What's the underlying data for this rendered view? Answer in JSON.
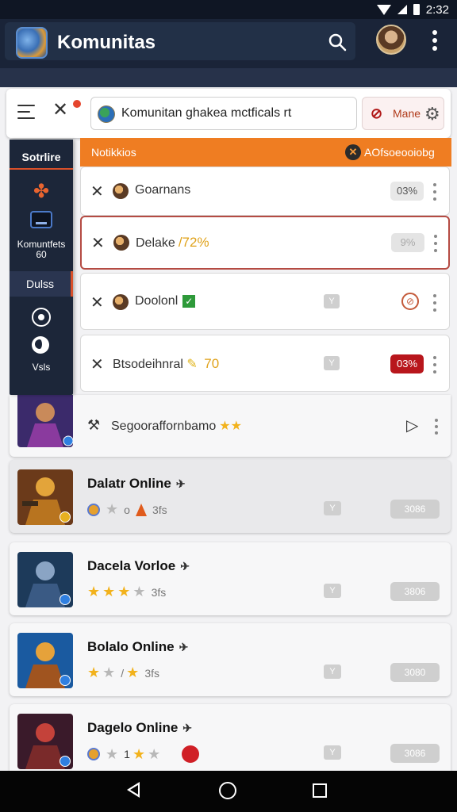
{
  "status_bar": {
    "time": "2:32"
  },
  "app_bar": {
    "title": "Komunitas"
  },
  "toolbar": {
    "field_text": "Komunitan ghakea mctficals rt",
    "right_label": "Mane"
  },
  "side_panel": {
    "header": "Sotrlire",
    "item1_label": "Komuntfets 60",
    "section2": "Dulss",
    "item2_label": "Vsls"
  },
  "notifications": {
    "header_title": "Notikkios",
    "header_right": "AOfsoeooiobg",
    "rows": [
      {
        "text": "Goarnans",
        "pct": "03%"
      },
      {
        "text": "Delake",
        "extra": "/72%",
        "pct": "9%"
      },
      {
        "text": "Doolonl",
        "tag": "Y"
      },
      {
        "text": "Btsodeihnral",
        "extra": "70",
        "tag": "Y",
        "pct": "03%"
      }
    ]
  },
  "partial_card": {
    "text": "Segooraffornbamo",
    "stars": "★★"
  },
  "games": [
    {
      "title": "Dalatr Online",
      "rating_text": "3fs",
      "tag": "Y",
      "button": "3086"
    },
    {
      "title": "Dacela Vorloe",
      "rating_text": "3fs",
      "tag": "Y",
      "button": "3806"
    },
    {
      "title": "Bolalo Online",
      "rating_text": "3fs",
      "tag": "Y",
      "button": "3080"
    },
    {
      "title": "Dagelo Online",
      "rating_text": "1",
      "tag": "Y",
      "button": "3086"
    }
  ],
  "colors": {
    "accent": "#ef7d22",
    "appbar": "#1a2438",
    "danger": "#b8161c"
  }
}
